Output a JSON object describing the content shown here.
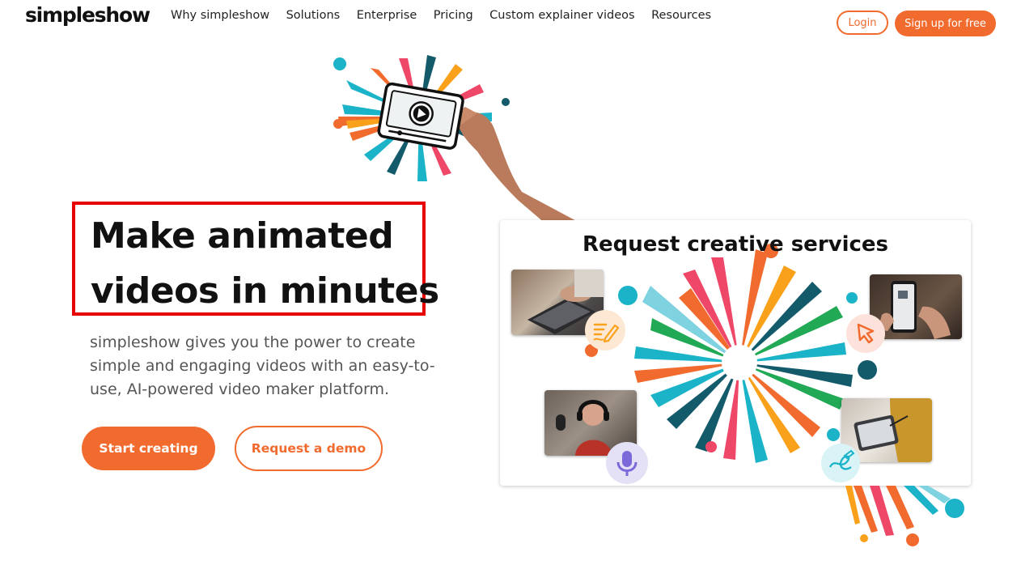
{
  "header": {
    "logo": "simpleshow",
    "nav": [
      "Why simpleshow",
      "Solutions",
      "Enterprise",
      "Pricing",
      "Custom explainer videos",
      "Resources"
    ],
    "login_label": "Login",
    "signup_label": "Sign up for free"
  },
  "hero": {
    "title_line1": "Make animated",
    "title_line2": "videos in minutes",
    "subtitle": "simpleshow gives you the power to create simple and engaging videos with an easy-to-use, AI-powered video maker platform.",
    "start_label": "Start creating",
    "demo_label": "Request a demo"
  },
  "services_card": {
    "title": "Request creative services",
    "icons": [
      "writing-icon",
      "pointer-cursor-icon",
      "microphone-icon",
      "drawing-icon",
      "play-icon"
    ]
  },
  "colors": {
    "accent": "#f26b2e",
    "teal": "#1ab3c8",
    "dark_teal": "#135a6b",
    "pink": "#ef4768",
    "green": "#22a955",
    "yellow": "#f9a11b",
    "highlight_box": "#e80000"
  }
}
